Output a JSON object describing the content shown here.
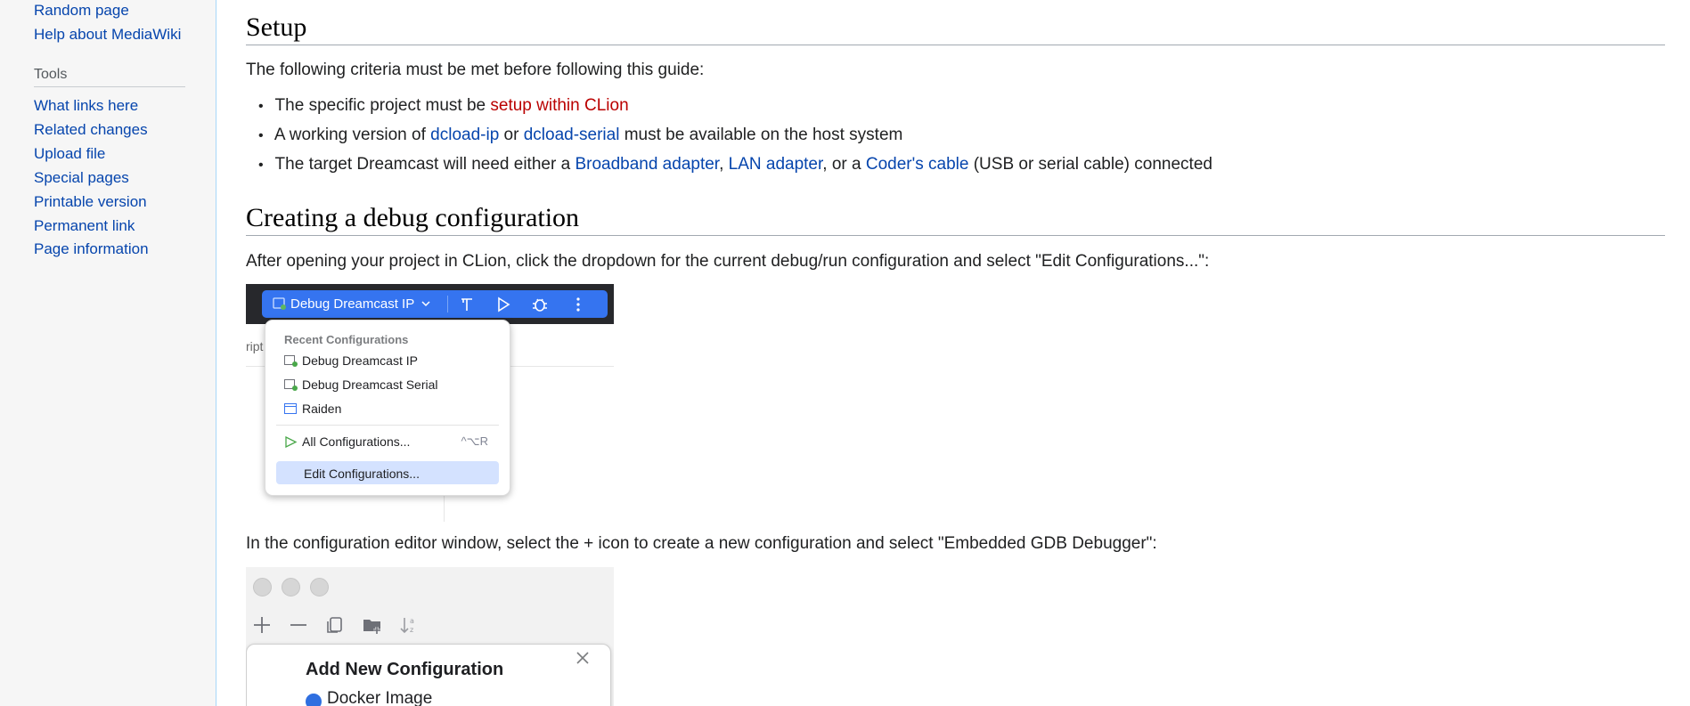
{
  "sidebar": {
    "nav_links": [
      {
        "label": "Random page"
      },
      {
        "label": "Help about MediaWiki"
      }
    ],
    "tools_heading": "Tools",
    "tools_links": [
      {
        "label": "What links here"
      },
      {
        "label": "Related changes"
      },
      {
        "label": "Upload file"
      },
      {
        "label": "Special pages"
      },
      {
        "label": "Printable version"
      },
      {
        "label": "Permanent link"
      },
      {
        "label": "Page information"
      }
    ]
  },
  "setup": {
    "heading": "Setup",
    "intro": "The following criteria must be met before following this guide:",
    "bullets": {
      "b1_pre": "The specific project must be ",
      "b1_link": "setup within CLion",
      "b2_pre": "A working version of ",
      "b2_link1": "dcload-ip",
      "b2_mid": " or ",
      "b2_link2": "dcload-serial",
      "b2_post": " must be available on the host system",
      "b3_pre": "The target Dreamcast will need either a ",
      "b3_link1": "Broadband adapter",
      "b3_sep1": ", ",
      "b3_link2": "LAN adapter",
      "b3_sep2": ", or a ",
      "b3_link3": "Coder's cable",
      "b3_post": " (USB or serial cable) connected"
    }
  },
  "debug": {
    "heading": "Creating a debug configuration",
    "para1": "After opening your project in CLion, click the dropdown for the current debug/run configuration and select \"Edit Configurations...\":",
    "para2": "In the configuration editor window, select the + icon to create a new configuration and select \"Embedded GDB Debugger\":"
  },
  "screenshot1": {
    "run_config_label": "Debug Dreamcast IP",
    "ghost_text": "ript",
    "menu_heading": "Recent Configurations",
    "items": [
      "Debug Dreamcast IP",
      "Debug Dreamcast Serial",
      "Raiden"
    ],
    "all_configs": "All Configurations...",
    "all_configs_shortcut": "^⌥R",
    "edit_configs": "Edit Configurations..."
  },
  "screenshot2": {
    "popup_title": "Add New Configuration",
    "first_item": "Docker Image"
  },
  "colors": {
    "link": "#0645ad",
    "redlink": "#ba0000",
    "clion_blue": "#3574f0",
    "menu_highlight": "#d4e2ff"
  }
}
